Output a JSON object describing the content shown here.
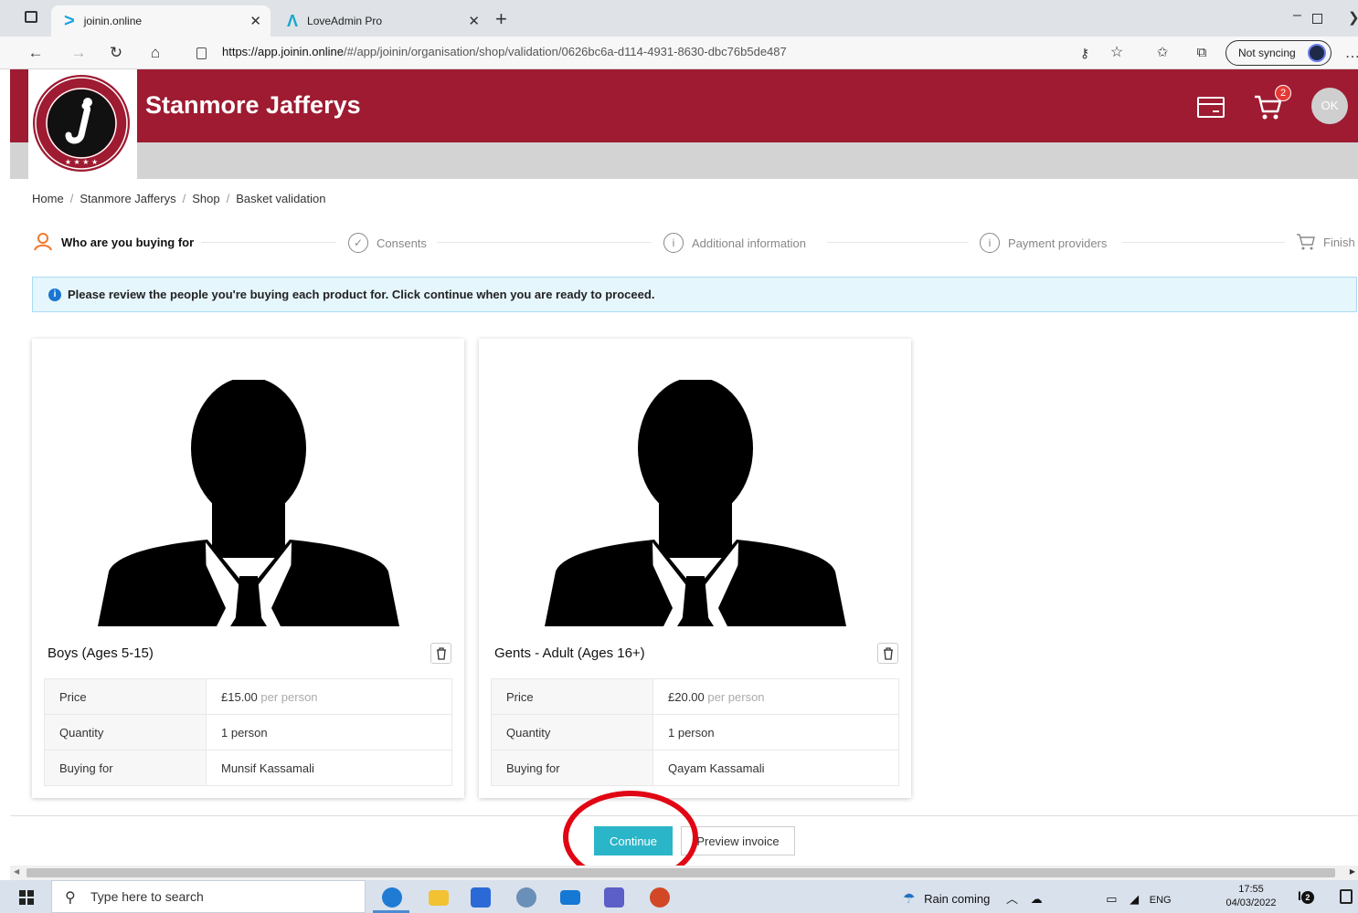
{
  "browser": {
    "tabs": [
      {
        "title": "joinin.online",
        "icon": "chevron-right-icon"
      },
      {
        "title": "LoveAdmin Pro",
        "icon": "loveadmin-logo-icon"
      }
    ],
    "url_host": "https://app.joinin.online",
    "url_path": "/#/app/joinin/organisation/shop/validation/0626bc6a-d114-4931-8630-dbc76b5de487",
    "sync_label": "Not syncing"
  },
  "header": {
    "club_name": "Stanmore Jafferys",
    "logo_text": "STANMORE JAFFERYS",
    "cart_count": "2",
    "avatar_initials": "OK",
    "colors": {
      "brand": "#9e1b32",
      "accent": "#2bb5c8"
    }
  },
  "breadcrumb": [
    "Home",
    "Stanmore Jafferys",
    "Shop",
    "Basket validation"
  ],
  "steps": [
    {
      "label": "Who are you buying for",
      "active": true
    },
    {
      "label": "Consents",
      "active": false
    },
    {
      "label": "Additional information",
      "active": false
    },
    {
      "label": "Payment providers",
      "active": false
    },
    {
      "label": "Finish",
      "active": false
    }
  ],
  "info_message": "Please review the people you're buying each product for. Click continue when you are ready to proceed.",
  "products": [
    {
      "title": "Boys (Ages 5-15)",
      "rows": [
        {
          "label": "Price",
          "value": "£15.00",
          "suffix": "per person"
        },
        {
          "label": "Quantity",
          "value": "1 person",
          "suffix": ""
        },
        {
          "label": "Buying for",
          "value": "Munsif Kassamali",
          "suffix": ""
        }
      ]
    },
    {
      "title": "Gents - Adult (Ages 16+)",
      "rows": [
        {
          "label": "Price",
          "value": "£20.00",
          "suffix": "per person"
        },
        {
          "label": "Quantity",
          "value": "1 person",
          "suffix": ""
        },
        {
          "label": "Buying for",
          "value": "Qayam Kassamali",
          "suffix": ""
        }
      ]
    }
  ],
  "actions": {
    "continue": "Continue",
    "preview_invoice": "Preview invoice"
  },
  "taskbar": {
    "search_placeholder": "Type here to search",
    "weather": "Rain coming",
    "language": "ENG",
    "time": "17:55",
    "date": "04/03/2022",
    "notification_count": "2"
  }
}
